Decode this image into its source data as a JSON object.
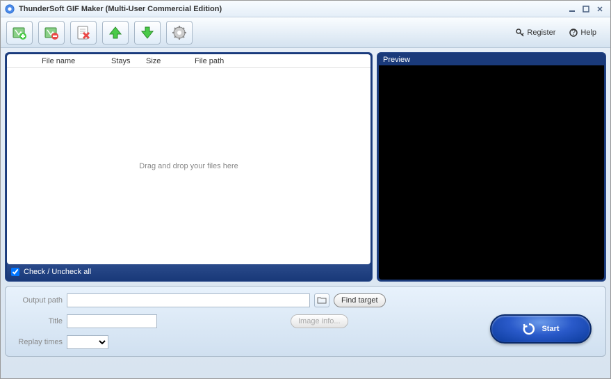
{
  "window": {
    "title": "ThunderSoft GIF Maker (Multi-User Commercial Edition)"
  },
  "toolbar": {
    "register": "Register",
    "help": "Help"
  },
  "filelist": {
    "columns": {
      "filename": "File name",
      "stays": "Stays",
      "size": "Size",
      "filepath": "File path"
    },
    "dropzone_text": "Drag and drop your files here",
    "check_all_label": "Check / Uncheck all"
  },
  "preview": {
    "label": "Preview"
  },
  "form": {
    "output_path_label": "Output path",
    "output_path_value": "",
    "find_target_label": "Find target",
    "title_label": "Title",
    "title_value": "",
    "image_info_label": "Image info...",
    "replay_label": "Replay times",
    "replay_value": ""
  },
  "start": {
    "label": "Start"
  }
}
